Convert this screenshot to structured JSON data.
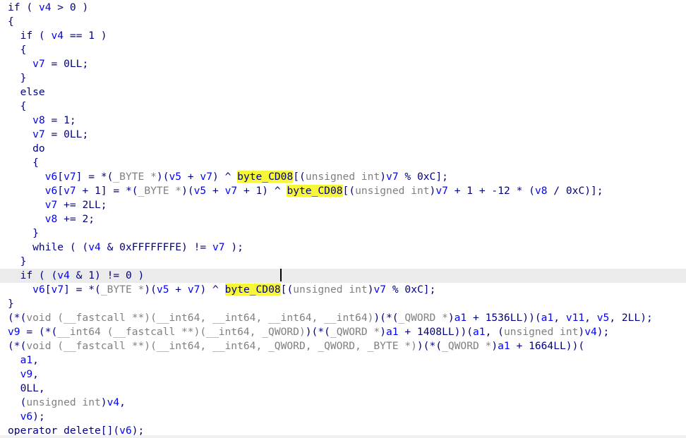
{
  "colors": {
    "text": "#000080",
    "variable": "#0000ff",
    "type": "#808080",
    "highlight": "#f7f73a",
    "current_line": "#ebebeb",
    "background": "#ffffff"
  },
  "code_lines": [
    {
      "tokens": [
        {
          "t": "if ( ",
          "c": "kw"
        },
        {
          "t": "v4",
          "c": "var"
        },
        {
          "t": " > 0 )",
          "c": "op"
        }
      ]
    },
    {
      "tokens": [
        {
          "t": "{",
          "c": "op"
        }
      ]
    },
    {
      "tokens": [
        {
          "t": "  if ( ",
          "c": "kw"
        },
        {
          "t": "v4",
          "c": "var"
        },
        {
          "t": " == 1 )",
          "c": "op"
        }
      ]
    },
    {
      "tokens": [
        {
          "t": "  {",
          "c": "op"
        }
      ]
    },
    {
      "tokens": [
        {
          "t": "    ",
          "c": "op"
        },
        {
          "t": "v7",
          "c": "var"
        },
        {
          "t": " = 0LL;",
          "c": "op"
        }
      ]
    },
    {
      "tokens": [
        {
          "t": "  }",
          "c": "op"
        }
      ]
    },
    {
      "tokens": [
        {
          "t": "  else",
          "c": "kw"
        }
      ]
    },
    {
      "tokens": [
        {
          "t": "  {",
          "c": "op"
        }
      ]
    },
    {
      "tokens": [
        {
          "t": "    ",
          "c": "op"
        },
        {
          "t": "v8",
          "c": "var"
        },
        {
          "t": " = 1;",
          "c": "op"
        }
      ]
    },
    {
      "tokens": [
        {
          "t": "    ",
          "c": "op"
        },
        {
          "t": "v7",
          "c": "var"
        },
        {
          "t": " = 0LL;",
          "c": "op"
        }
      ]
    },
    {
      "tokens": [
        {
          "t": "    do",
          "c": "kw"
        }
      ]
    },
    {
      "tokens": [
        {
          "t": "    {",
          "c": "op"
        }
      ]
    },
    {
      "tokens": [
        {
          "t": "      ",
          "c": "op"
        },
        {
          "t": "v6",
          "c": "var"
        },
        {
          "t": "[",
          "c": "op"
        },
        {
          "t": "v7",
          "c": "var"
        },
        {
          "t": "] = *(",
          "c": "op"
        },
        {
          "t": "_BYTE *",
          "c": "typ"
        },
        {
          "t": ")(",
          "c": "op"
        },
        {
          "t": "v5",
          "c": "var"
        },
        {
          "t": " + ",
          "c": "op"
        },
        {
          "t": "v7",
          "c": "var"
        },
        {
          "t": ") ^ ",
          "c": "op"
        },
        {
          "t": "byte_CD08",
          "c": "hl"
        },
        {
          "t": "[(",
          "c": "op"
        },
        {
          "t": "unsigned int",
          "c": "typ"
        },
        {
          "t": ")",
          "c": "op"
        },
        {
          "t": "v7",
          "c": "var"
        },
        {
          "t": " % 0xC];",
          "c": "op"
        }
      ]
    },
    {
      "tokens": [
        {
          "t": "      ",
          "c": "op"
        },
        {
          "t": "v6",
          "c": "var"
        },
        {
          "t": "[",
          "c": "op"
        },
        {
          "t": "v7",
          "c": "var"
        },
        {
          "t": " + 1] = *(",
          "c": "op"
        },
        {
          "t": "_BYTE *",
          "c": "typ"
        },
        {
          "t": ")(",
          "c": "op"
        },
        {
          "t": "v5",
          "c": "var"
        },
        {
          "t": " + ",
          "c": "op"
        },
        {
          "t": "v7",
          "c": "var"
        },
        {
          "t": " + 1) ^ ",
          "c": "op"
        },
        {
          "t": "byte_CD08",
          "c": "hl"
        },
        {
          "t": "[(",
          "c": "op"
        },
        {
          "t": "unsigned int",
          "c": "typ"
        },
        {
          "t": ")",
          "c": "op"
        },
        {
          "t": "v7",
          "c": "var"
        },
        {
          "t": " + 1 + -12 * (",
          "c": "op"
        },
        {
          "t": "v8",
          "c": "var"
        },
        {
          "t": " / 0xC)];",
          "c": "op"
        }
      ]
    },
    {
      "tokens": [
        {
          "t": "      ",
          "c": "op"
        },
        {
          "t": "v7",
          "c": "var"
        },
        {
          "t": " += 2LL;",
          "c": "op"
        }
      ]
    },
    {
      "tokens": [
        {
          "t": "      ",
          "c": "op"
        },
        {
          "t": "v8",
          "c": "var"
        },
        {
          "t": " += 2;",
          "c": "op"
        }
      ]
    },
    {
      "tokens": [
        {
          "t": "    }",
          "c": "op"
        }
      ]
    },
    {
      "tokens": [
        {
          "t": "    while ( (",
          "c": "kw"
        },
        {
          "t": "v4",
          "c": "var"
        },
        {
          "t": " & 0xFFFFFFFE) != ",
          "c": "op"
        },
        {
          "t": "v7",
          "c": "var"
        },
        {
          "t": " );",
          "c": "op"
        }
      ]
    },
    {
      "tokens": [
        {
          "t": "  }",
          "c": "op"
        }
      ]
    },
    {
      "current": true,
      "tokens": [
        {
          "t": "  if ( (",
          "c": "kw"
        },
        {
          "t": "v4",
          "c": "var"
        },
        {
          "t": " & 1) != 0 )",
          "c": "op"
        }
      ]
    },
    {
      "tokens": [
        {
          "t": "    ",
          "c": "op"
        },
        {
          "t": "v6",
          "c": "var"
        },
        {
          "t": "[",
          "c": "op"
        },
        {
          "t": "v7",
          "c": "var"
        },
        {
          "t": "] = *(",
          "c": "op"
        },
        {
          "t": "_BYTE *",
          "c": "typ"
        },
        {
          "t": ")(",
          "c": "op"
        },
        {
          "t": "v5",
          "c": "var"
        },
        {
          "t": " + ",
          "c": "op"
        },
        {
          "t": "v7",
          "c": "var"
        },
        {
          "t": ") ^ ",
          "c": "op"
        },
        {
          "t": "byte_CD08",
          "c": "hl"
        },
        {
          "t": "[(",
          "c": "op"
        },
        {
          "t": "unsigned int",
          "c": "typ"
        },
        {
          "t": ")",
          "c": "op"
        },
        {
          "t": "v7",
          "c": "var"
        },
        {
          "t": " % 0xC];",
          "c": "op"
        }
      ]
    },
    {
      "tokens": [
        {
          "t": "}",
          "c": "op"
        }
      ]
    },
    {
      "tokens": [
        {
          "t": "(*(",
          "c": "op"
        },
        {
          "t": "void (__fastcall **)(__int64, __int64, __int64, __int64)",
          "c": "typ"
        },
        {
          "t": ")(*(",
          "c": "op"
        },
        {
          "t": "_QWORD *",
          "c": "typ"
        },
        {
          "t": ")",
          "c": "op"
        },
        {
          "t": "a1",
          "c": "var"
        },
        {
          "t": " + 1536LL))(",
          "c": "op"
        },
        {
          "t": "a1",
          "c": "var"
        },
        {
          "t": ", ",
          "c": "op"
        },
        {
          "t": "v11",
          "c": "var"
        },
        {
          "t": ", ",
          "c": "op"
        },
        {
          "t": "v5",
          "c": "var"
        },
        {
          "t": ", 2LL);",
          "c": "op"
        }
      ]
    },
    {
      "tokens": [
        {
          "t": "v9",
          "c": "var"
        },
        {
          "t": " = (*(",
          "c": "op"
        },
        {
          "t": "__int64 (__fastcall **)(__int64, _QWORD)",
          "c": "typ"
        },
        {
          "t": ")(*(",
          "c": "op"
        },
        {
          "t": "_QWORD *",
          "c": "typ"
        },
        {
          "t": ")",
          "c": "op"
        },
        {
          "t": "a1",
          "c": "var"
        },
        {
          "t": " + 1408LL))(",
          "c": "op"
        },
        {
          "t": "a1",
          "c": "var"
        },
        {
          "t": ", (",
          "c": "op"
        },
        {
          "t": "unsigned int",
          "c": "typ"
        },
        {
          "t": ")",
          "c": "op"
        },
        {
          "t": "v4",
          "c": "var"
        },
        {
          "t": ");",
          "c": "op"
        }
      ]
    },
    {
      "tokens": [
        {
          "t": "(*(",
          "c": "op"
        },
        {
          "t": "void (__fastcall **)(__int64, __int64, _QWORD, _QWORD, _BYTE *)",
          "c": "typ"
        },
        {
          "t": ")(*(",
          "c": "op"
        },
        {
          "t": "_QWORD *",
          "c": "typ"
        },
        {
          "t": ")",
          "c": "op"
        },
        {
          "t": "a1",
          "c": "var"
        },
        {
          "t": " + 1664LL))(",
          "c": "op"
        }
      ]
    },
    {
      "tokens": [
        {
          "t": "  ",
          "c": "op"
        },
        {
          "t": "a1",
          "c": "var"
        },
        {
          "t": ",",
          "c": "op"
        }
      ]
    },
    {
      "tokens": [
        {
          "t": "  ",
          "c": "op"
        },
        {
          "t": "v9",
          "c": "var"
        },
        {
          "t": ",",
          "c": "op"
        }
      ]
    },
    {
      "tokens": [
        {
          "t": "  0LL,",
          "c": "op"
        }
      ]
    },
    {
      "tokens": [
        {
          "t": "  (",
          "c": "op"
        },
        {
          "t": "unsigned int",
          "c": "typ"
        },
        {
          "t": ")",
          "c": "op"
        },
        {
          "t": "v4",
          "c": "var"
        },
        {
          "t": ",",
          "c": "op"
        }
      ]
    },
    {
      "tokens": [
        {
          "t": "  ",
          "c": "op"
        },
        {
          "t": "v6",
          "c": "var"
        },
        {
          "t": ");",
          "c": "op"
        }
      ]
    },
    {
      "tokens": [
        {
          "t": "operator delete[](",
          "c": "op"
        },
        {
          "t": "v6",
          "c": "var"
        },
        {
          "t": ");",
          "c": "op"
        }
      ]
    }
  ]
}
